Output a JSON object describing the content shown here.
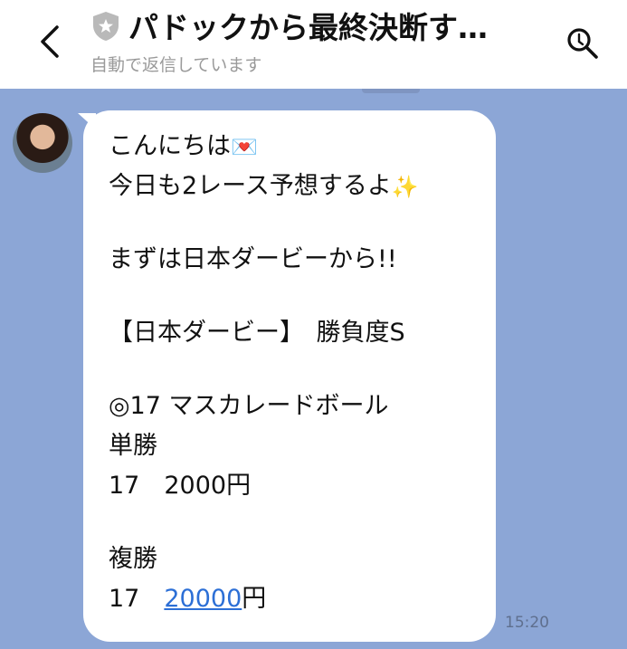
{
  "header": {
    "title": "パドックから最終決断す…",
    "subtitle": "自動で返信しています"
  },
  "message": {
    "lines": [
      {
        "text": "こんにちは",
        "emoji": "💌"
      },
      {
        "text": "今日も2レース予想するよ",
        "emoji": "✨"
      },
      {
        "text": ""
      },
      {
        "text": "まずは日本ダービーから!!"
      },
      {
        "text": ""
      },
      {
        "text": "【日本ダービー】　勝負度S"
      },
      {
        "text": ""
      },
      {
        "text": "◎17 マスカレードボール"
      },
      {
        "text": "単勝"
      },
      {
        "text": "17　2000円"
      },
      {
        "text": ""
      },
      {
        "text": "複勝"
      },
      {
        "text": "17　",
        "link": "20000",
        "suffix": "円"
      }
    ],
    "time": "15:20"
  },
  "colors": {
    "chat_background": "#8ca6d6",
    "bubble": "#ffffff",
    "link": "#2c6fd6"
  },
  "icons": [
    "back-arrow-icon",
    "shield-icon",
    "search-icon",
    "envelope-heart-emoji",
    "sparkles-emoji"
  ]
}
